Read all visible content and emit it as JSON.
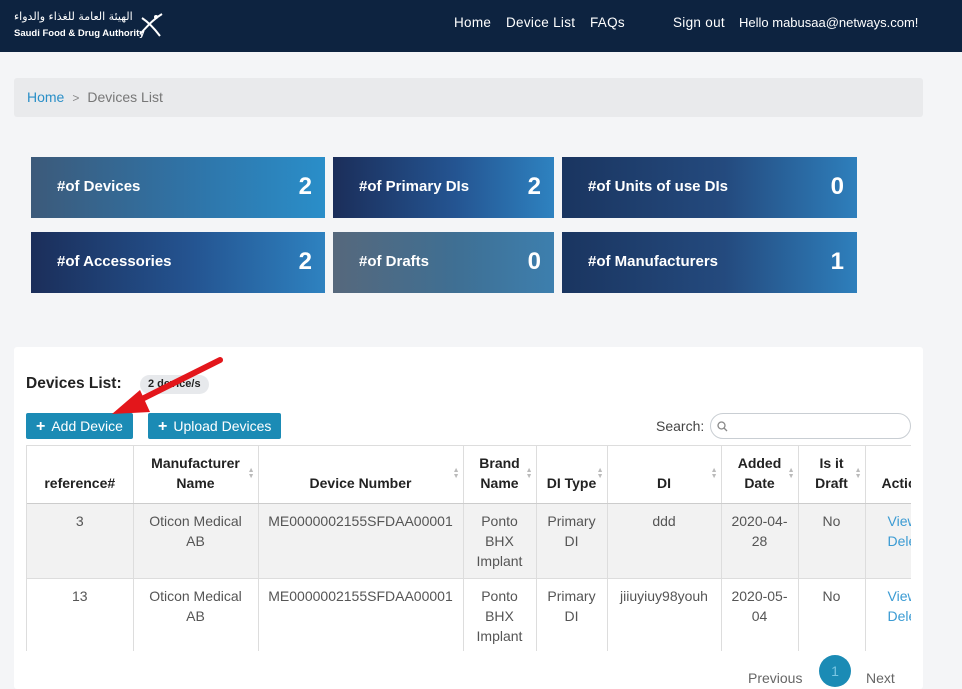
{
  "header": {
    "logo_arabic": "الهيئة العامة للغذاء والدواء",
    "logo_english": "Saudi Food & Drug Authority",
    "nav": [
      "Home",
      "Device List",
      "FAQs"
    ],
    "sign_out": "Sign out",
    "greeting": "Hello mabusaa@netways.com!"
  },
  "breadcrumb": {
    "home": "Home",
    "separator": ">",
    "current": "Devices List"
  },
  "stats": [
    {
      "label": "#of Devices",
      "value": "2"
    },
    {
      "label": "#of Primary DIs",
      "value": "2"
    },
    {
      "label": "#of Units of use DIs",
      "value": "0"
    },
    {
      "label": "#of Accessories",
      "value": "2"
    },
    {
      "label": "#of Drafts",
      "value": "0"
    },
    {
      "label": "#of Manufacturers",
      "value": "1"
    }
  ],
  "devices_list": {
    "title": "Devices List:",
    "count_badge": "2 device/s",
    "add_button": "Add Device",
    "upload_button": "Upload Devices",
    "search_label": "Search:",
    "search_value": "",
    "columns": [
      "reference#",
      "Manufacturer Name",
      "Device Number",
      "Brand Name",
      "DI Type",
      "DI",
      "Added Date",
      "Is it Draft",
      "Actions"
    ],
    "rows": [
      {
        "reference": "3",
        "manufacturer": "Oticon Medical AB",
        "device_number": "ME0000002155SFDAA00001",
        "brand": "Ponto BHX Implant",
        "di_type": "Primary DI",
        "di": "ddd",
        "added_date": "2020-04-28",
        "draft": "No",
        "view": "View",
        "delete": "Delete"
      },
      {
        "reference": "13",
        "manufacturer": "Oticon Medical AB",
        "device_number": "ME0000002155SFDAA00001",
        "brand": "Ponto BHX Implant",
        "di_type": "Primary DI",
        "di": "jiiuyiuy98youh",
        "added_date": "2020-05-04",
        "draft": "No",
        "view": "View",
        "delete": "Delete"
      }
    ]
  },
  "pagination": {
    "previous": "Previous",
    "current_page": "1",
    "next": "Next"
  },
  "colors": {
    "header_bg": "#0d2340",
    "accent": "#1b8bb5",
    "annotation_arrow": "#e3161b"
  }
}
